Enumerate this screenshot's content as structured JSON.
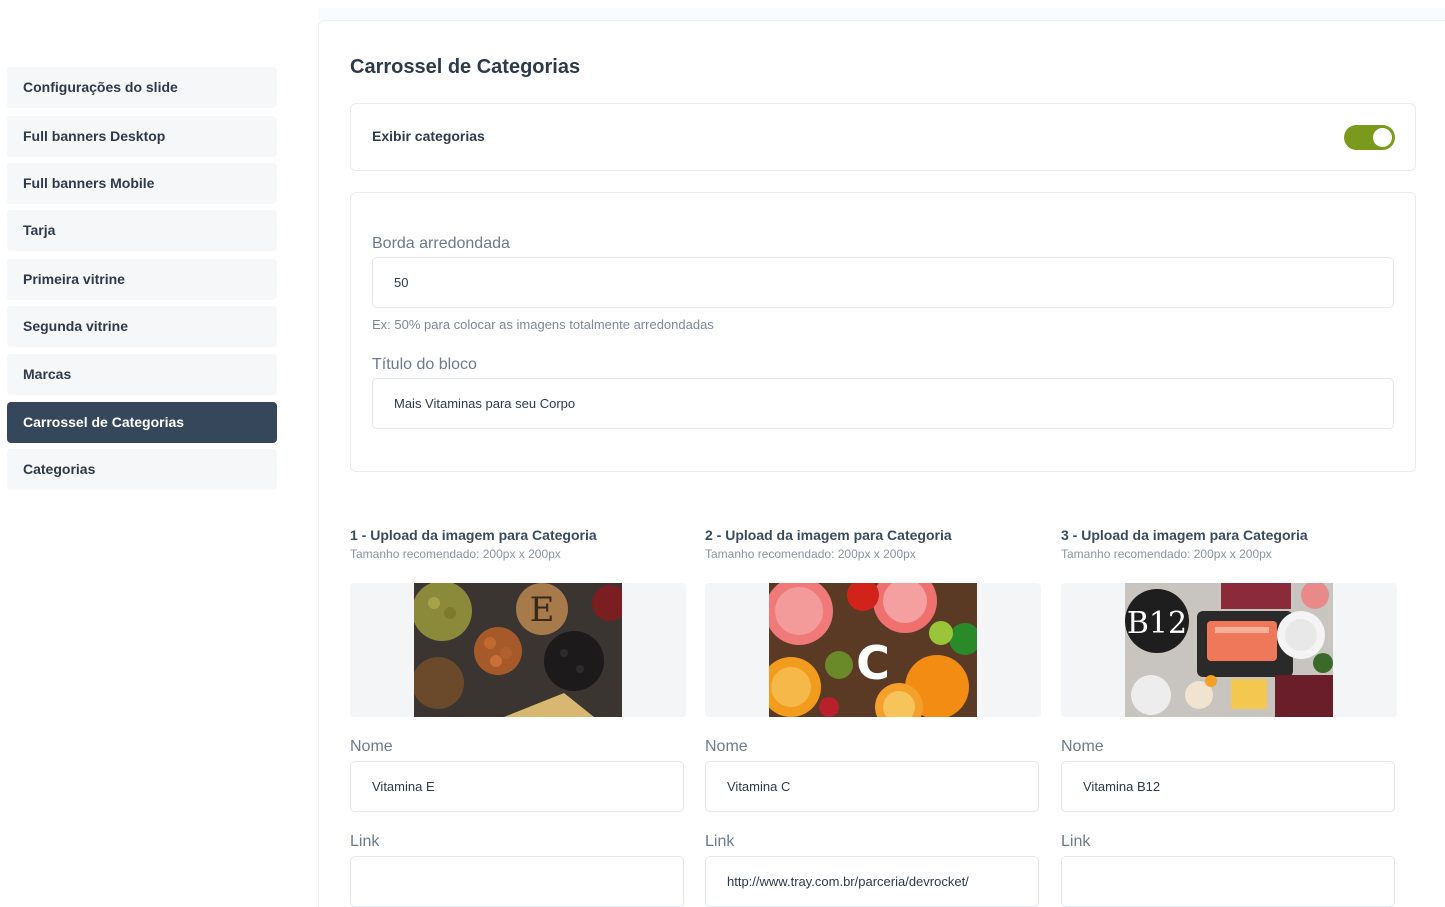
{
  "sidebar": {
    "items": [
      {
        "label": "Configurações do slide",
        "active": false
      },
      {
        "label": "Full banners Desktop",
        "active": false
      },
      {
        "label": "Full banners Mobile",
        "active": false
      },
      {
        "label": "Tarja",
        "active": false
      },
      {
        "label": "Primeira vitrine",
        "active": false
      },
      {
        "label": "Segunda vitrine",
        "active": false
      },
      {
        "label": "Marcas",
        "active": false
      },
      {
        "label": "Carrossel de Categorias",
        "active": true
      },
      {
        "label": "Categorias",
        "active": false
      }
    ]
  },
  "main": {
    "title": "Carrossel de Categorias",
    "toggle": {
      "label": "Exibir categorias",
      "on": true
    },
    "border_radius": {
      "label": "Borda arredondada",
      "value": "50",
      "hint": "Ex: 50% para colocar as imagens totalmente arredondadas"
    },
    "block_title": {
      "label": "Título do bloco",
      "value": "Mais Vitaminas para seu Corpo"
    },
    "categories": [
      {
        "upload_title": "1 - Upload da imagem para Categoria",
        "size_hint": "Tamanho recomendado: 200px x 200px",
        "image_letter": "E",
        "name_label": "Nome",
        "name_value": "Vitamina E",
        "link_label": "Link",
        "link_value": ""
      },
      {
        "upload_title": "2 - Upload da imagem para Categoria",
        "size_hint": "Tamanho recomendado: 200px x 200px",
        "image_letter": "C",
        "name_label": "Nome",
        "name_value": "Vitamina C",
        "link_label": "Link",
        "link_value": "http://www.tray.com.br/parceria/devrocket/"
      },
      {
        "upload_title": "3 - Upload da imagem para Categoria",
        "size_hint": "Tamanho recomendado: 200px x 200px",
        "image_letter": "B12",
        "name_label": "Nome",
        "name_value": "Vitamina B12",
        "link_label": "Link",
        "link_value": ""
      }
    ]
  },
  "colors": {
    "accent_toggle": "#7a9a1e",
    "active_sidebar": "#36475c"
  }
}
